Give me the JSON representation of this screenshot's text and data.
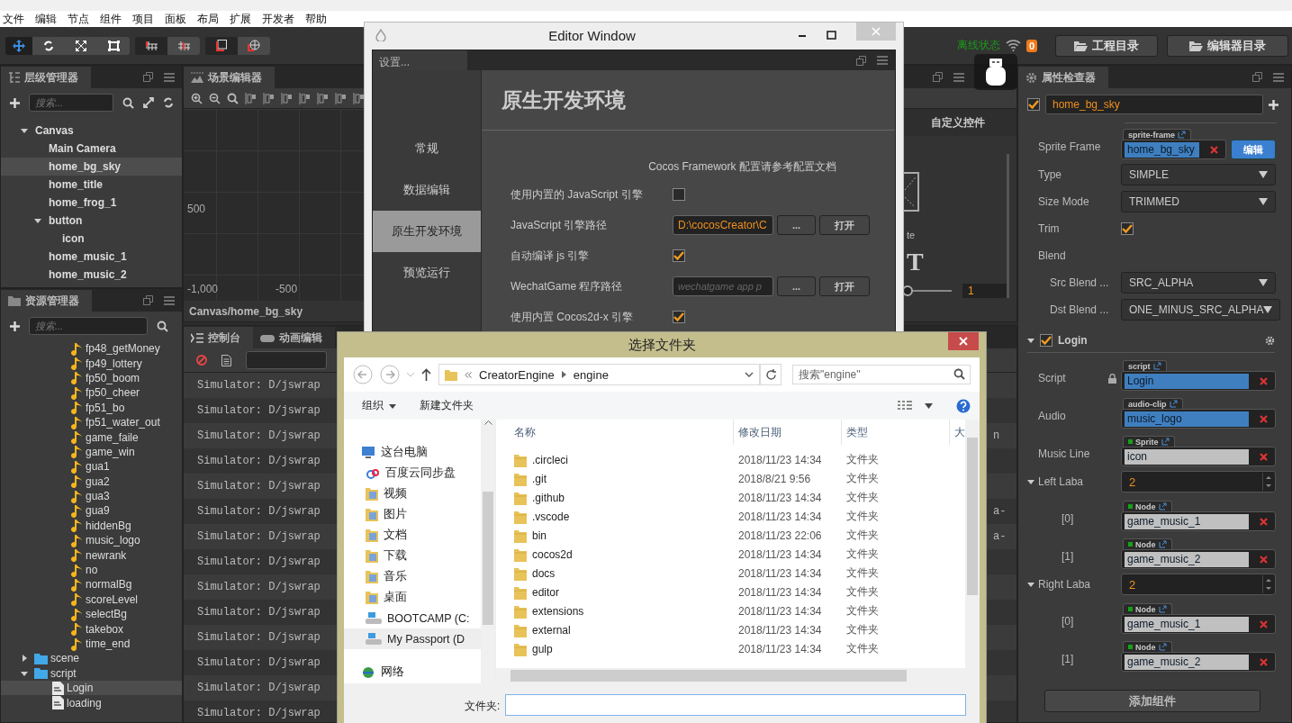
{
  "menu": [
    "文件",
    "编辑",
    "节点",
    "组件",
    "项目",
    "面板",
    "布局",
    "扩展",
    "开发者",
    "帮助"
  ],
  "toolbar": {
    "status": "离线状态",
    "badge": "0",
    "buttons": [
      "工程目录",
      "编辑器目录"
    ]
  },
  "hierarchy": {
    "title": "层级管理器",
    "search_placeholder": "搜索...",
    "tree": [
      {
        "label": "Canvas",
        "selected": false,
        "expanded": true,
        "children": [
          {
            "label": "Main Camera",
            "selected": false
          },
          {
            "label": "home_bg_sky",
            "selected": true
          },
          {
            "label": "home_title",
            "selected": false
          },
          {
            "label": "home_frog_1",
            "selected": false
          },
          {
            "label": "button",
            "selected": false,
            "expanded": true,
            "children": [
              {
                "label": "icon",
                "selected": false
              }
            ]
          },
          {
            "label": "home_music_1",
            "selected": false
          },
          {
            "label": "home_music_2",
            "selected": false
          }
        ]
      }
    ]
  },
  "assets": {
    "title": "资源管理器",
    "search_placeholder": "搜索...",
    "partial_folder_items": [
      {
        "label": "fp48_getMoney",
        "kind": "audio",
        "selected": false
      },
      {
        "label": "fp49_lottery",
        "kind": "audio",
        "selected": false
      },
      {
        "label": "fp50_boom",
        "kind": "audio",
        "selected": false
      },
      {
        "label": "fp50_cheer",
        "kind": "audio",
        "selected": false
      },
      {
        "label": "fp51_bo",
        "kind": "audio",
        "selected": false
      },
      {
        "label": "fp51_water_out",
        "kind": "audio",
        "selected": false
      },
      {
        "label": "game_faile",
        "kind": "audio",
        "selected": false
      },
      {
        "label": "game_win",
        "kind": "audio",
        "selected": false
      },
      {
        "label": "gua1",
        "kind": "audio",
        "selected": false
      },
      {
        "label": "gua2",
        "kind": "audio",
        "selected": false
      },
      {
        "label": "gua3",
        "kind": "audio",
        "selected": false
      },
      {
        "label": "gua9",
        "kind": "audio",
        "selected": false
      },
      {
        "label": "hiddenBg",
        "kind": "audio",
        "selected": false
      },
      {
        "label": "music_logo",
        "kind": "audio",
        "selected": false
      },
      {
        "label": "newrank",
        "kind": "audio",
        "selected": false
      },
      {
        "label": "no",
        "kind": "audio",
        "selected": false
      },
      {
        "label": "normalBg",
        "kind": "audio",
        "selected": false
      },
      {
        "label": "scoreLevel",
        "kind": "audio",
        "selected": false
      },
      {
        "label": "selectBg",
        "kind": "audio",
        "selected": false
      },
      {
        "label": "takebox",
        "kind": "audio",
        "selected": false
      },
      {
        "label": "time_end",
        "kind": "audio",
        "selected": false
      }
    ],
    "tree": [
      {
        "label": "scene",
        "kind": "folder",
        "selected": false,
        "expanded": false
      },
      {
        "label": "script",
        "kind": "folder",
        "selected": false,
        "expanded": true,
        "children": [
          {
            "label": "Login",
            "kind": "script",
            "selected": true
          },
          {
            "label": "loading",
            "kind": "script",
            "selected": false
          }
        ]
      }
    ]
  },
  "scene": {
    "title": "场景编辑器",
    "y_labels": [
      "500"
    ],
    "x_labels": [
      "-1,000",
      "-500"
    ],
    "breadcrumb": "Canvas/home_bg_sky",
    "side_panel": {
      "title": "自定义控件",
      "fragment": "te",
      "glyph": "T",
      "value": "1",
      "level": 0.05
    }
  },
  "console": {
    "tabs": [
      {
        "label": "控制台",
        "selected": true
      },
      {
        "label": "动画编辑",
        "selected": false
      }
    ],
    "lines": [
      {
        "text": "Simulator: D/jswrap"
      },
      {
        "text": "Simulator: D/jswrap"
      },
      {
        "text": "Simulator: D/jswrap",
        "tail": "n"
      },
      {
        "text": "Simulator: D/jswrap"
      },
      {
        "text": "Simulator: D/jswrap"
      },
      {
        "text": "Simulator: D/jswrap",
        "tail": "a-"
      },
      {
        "text": "Simulator: D/jswrap",
        "tail": "a-"
      },
      {
        "text": "Simulator: D/jswrap"
      },
      {
        "text": "Simulator: D/jswrap"
      },
      {
        "text": "Simulator: D/jswrap"
      },
      {
        "text": "Simulator: D/jswrap"
      },
      {
        "text": "Simulator: D/jswrap"
      },
      {
        "text": "Simulator: D/jswrap"
      },
      {
        "text": "Simulator: D/jswrap"
      }
    ]
  },
  "editor_window": {
    "title": "Editor Window",
    "tab": "设置...",
    "nav": [
      {
        "label": "常规",
        "selected": false
      },
      {
        "label": "数据编辑",
        "selected": false
      },
      {
        "label": "原生开发环境",
        "selected": true
      },
      {
        "label": "预览运行",
        "selected": false
      }
    ],
    "heading": "原生开发环境",
    "note": "Cocos Framework 配置请参考配置文档",
    "rows": [
      {
        "kind": "checkbox",
        "label": "使用内置的 JavaScript 引擎",
        "checked": false
      },
      {
        "kind": "path",
        "label": "JavaScript 引擎路径",
        "value": "D:\\cocosCreator\\C",
        "buttons": [
          "...",
          "打开"
        ]
      },
      {
        "kind": "checkbox",
        "label": "自动编译 js 引擎",
        "checked": true
      },
      {
        "kind": "path",
        "label": "WechatGame 程序路径",
        "placeholder": "wechatgame app p",
        "buttons": [
          "...",
          "打开"
        ]
      },
      {
        "kind": "checkbox",
        "label": "使用内置 Cocos2d-x 引擎",
        "checked": true
      }
    ]
  },
  "file_dialog": {
    "title": "选择文件夹",
    "path": [
      "CreatorEngine",
      "engine"
    ],
    "search_placeholder": "搜索\"engine\"",
    "organize": "组织",
    "new_folder": "新建文件夹",
    "nav": [
      {
        "label": "这台电脑",
        "kind": "pc",
        "selected": false
      },
      {
        "label": "百度云同步盘",
        "kind": "cloud",
        "selected": false
      },
      {
        "label": "视频",
        "kind": "folder",
        "selected": false
      },
      {
        "label": "图片",
        "kind": "folder",
        "selected": false
      },
      {
        "label": "文档",
        "kind": "folder",
        "selected": false
      },
      {
        "label": "下载",
        "kind": "folder",
        "selected": false
      },
      {
        "label": "音乐",
        "kind": "folder",
        "selected": false
      },
      {
        "label": "桌面",
        "kind": "folder",
        "selected": false
      },
      {
        "label": "BOOTCAMP (C:",
        "kind": "drive",
        "selected": false
      },
      {
        "label": "My Passport (D",
        "kind": "drive",
        "selected": true
      },
      {
        "label": "网络",
        "kind": "network",
        "selected": false
      }
    ],
    "columns": [
      "名称",
      "修改日期",
      "类型",
      "大"
    ],
    "rows": [
      {
        "name": ".circleci",
        "date": "2018/11/23 14:34",
        "type": "文件夹"
      },
      {
        "name": ".git",
        "date": "2018/8/21 9:56",
        "type": "文件夹"
      },
      {
        "name": ".github",
        "date": "2018/11/23 14:34",
        "type": "文件夹"
      },
      {
        "name": ".vscode",
        "date": "2018/11/23 14:34",
        "type": "文件夹"
      },
      {
        "name": "bin",
        "date": "2018/11/23 22:06",
        "type": "文件夹"
      },
      {
        "name": "cocos2d",
        "date": "2018/11/23 14:34",
        "type": "文件夹"
      },
      {
        "name": "docs",
        "date": "2018/11/23 14:34",
        "type": "文件夹"
      },
      {
        "name": "editor",
        "date": "2018/11/23 14:34",
        "type": "文件夹"
      },
      {
        "name": "extensions",
        "date": "2018/11/23 14:34",
        "type": "文件夹"
      },
      {
        "name": "external",
        "date": "2018/11/23 14:34",
        "type": "文件夹"
      },
      {
        "name": "gulp",
        "date": "2018/11/23 14:34",
        "type": "文件夹"
      }
    ],
    "folder_label": "文件夹:"
  },
  "inspector": {
    "title": "属性检查器",
    "node": {
      "enabled": true,
      "name": "home_bg_sky"
    },
    "props": [
      {
        "kind": "asset",
        "label": "Sprite Frame",
        "tag": "sprite-frame",
        "value": "home_bg_sky",
        "action": "编辑"
      },
      {
        "kind": "select",
        "label": "Type",
        "value": "SIMPLE"
      },
      {
        "kind": "select",
        "label": "Size Mode",
        "value": "TRIMMED"
      },
      {
        "kind": "checkbox",
        "label": "Trim",
        "checked": true
      },
      {
        "kind": "group",
        "label": "Blend",
        "children": [
          {
            "kind": "select",
            "label": "Src Blend ...",
            "value": "SRC_ALPHA"
          },
          {
            "kind": "select",
            "label": "Dst Blend ...",
            "value": "ONE_MINUS_SRC_ALPHA"
          }
        ]
      }
    ],
    "component": {
      "name": "Login",
      "enabled": true,
      "expanded": true,
      "props": [
        {
          "kind": "asset",
          "label": "Script",
          "tag": "script",
          "value": "Login",
          "locked": true
        },
        {
          "kind": "asset",
          "label": "Audio",
          "tag": "audio-clip",
          "value": "music_logo"
        },
        {
          "kind": "ref",
          "label": "Music Line",
          "tag": "Sprite",
          "value": "icon"
        },
        {
          "kind": "array",
          "label": "Left Laba",
          "count": "2",
          "expanded": true,
          "children": [
            {
              "kind": "ref",
              "label": "[0]",
              "tag": "Node",
              "value": "game_music_1"
            },
            {
              "kind": "ref",
              "label": "[1]",
              "tag": "Node",
              "value": "game_music_2"
            }
          ]
        },
        {
          "kind": "array",
          "label": "Right Laba",
          "count": "2",
          "expanded": true,
          "children": [
            {
              "kind": "ref",
              "label": "[0]",
              "tag": "Node",
              "value": "game_music_1"
            },
            {
              "kind": "ref",
              "label": "[1]",
              "tag": "Node",
              "value": "game_music_2"
            }
          ]
        }
      ]
    },
    "add_button": "添加组件"
  }
}
